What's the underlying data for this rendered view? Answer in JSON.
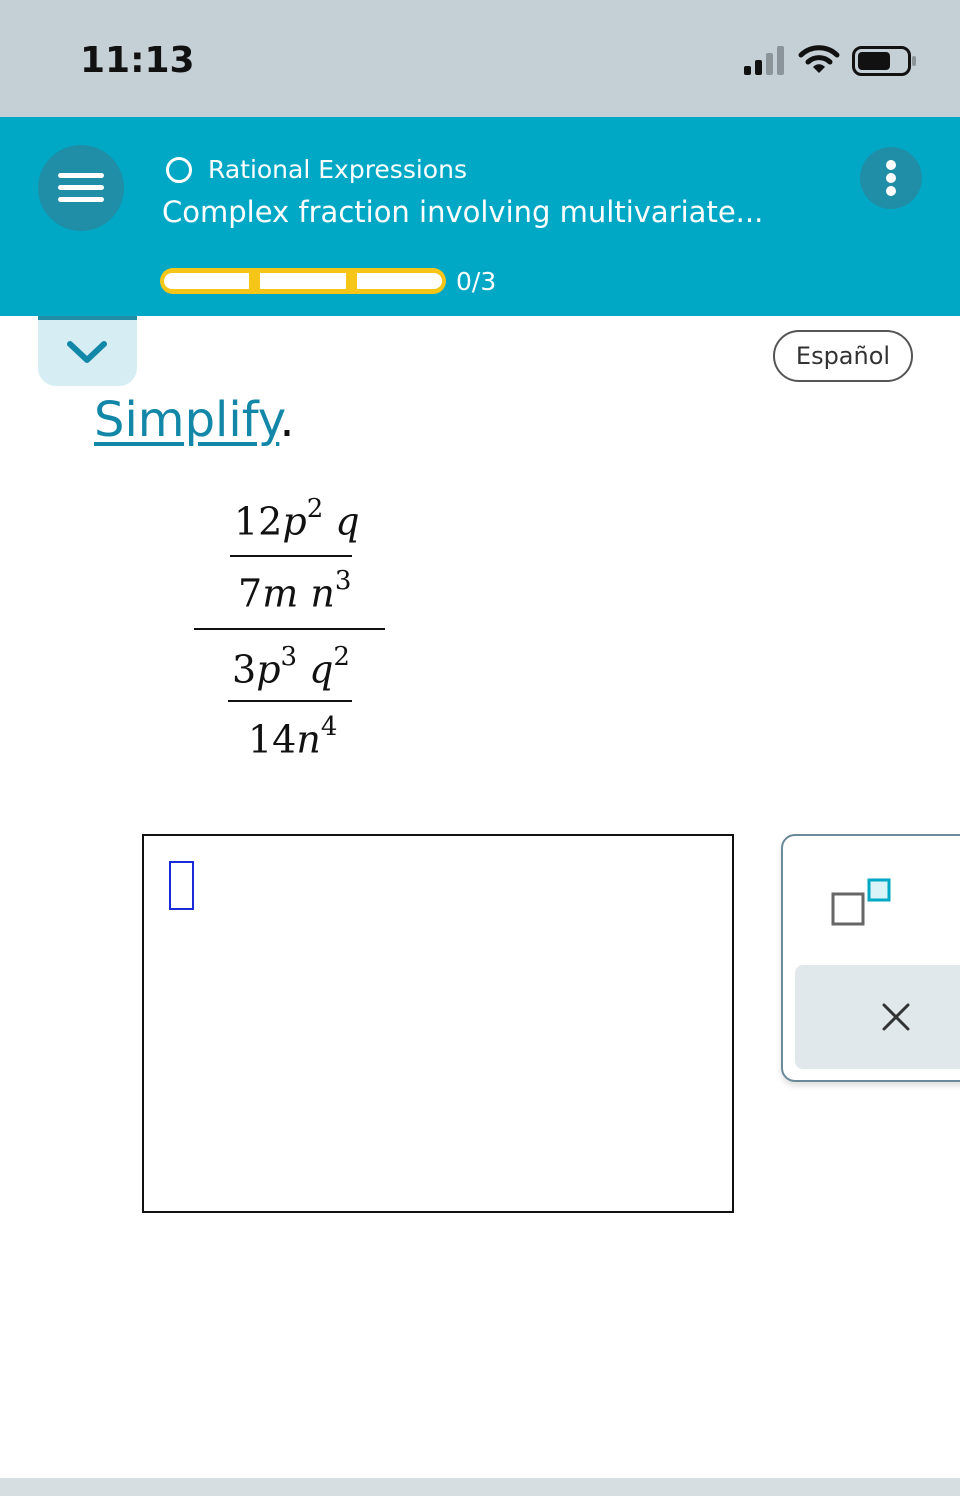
{
  "status_bar": {
    "time": "11:13"
  },
  "header": {
    "topic": "Rational Expressions",
    "title": "Complex fraction involving multivariate...",
    "progress": {
      "text": "0/3",
      "completed": 0,
      "total": 3
    }
  },
  "language_button": "Español",
  "problem": {
    "instruction_link": "Simplify",
    "instruction_suffix": ".",
    "expression": {
      "upper_numerator": {
        "coef": "12",
        "v1": "p",
        "e1": "2",
        "v2": "q"
      },
      "upper_denominator": {
        "coef": "7",
        "v1": "m",
        "v2": "n",
        "e2": "3"
      },
      "lower_numerator": {
        "coef": "3",
        "v1": "p",
        "e1": "3",
        "v2": "q",
        "e2": "2"
      },
      "lower_denominator": {
        "coef": "14",
        "v1": "n",
        "e1": "4"
      }
    }
  },
  "tools": {
    "superscript": "superscript-icon",
    "clear": "close-icon"
  },
  "colors": {
    "header": "#00a8c6",
    "accent_dark": "#1f8ea6",
    "progress": "#f5c518",
    "link": "#1287a8",
    "cursor": "#1a2bd8"
  }
}
